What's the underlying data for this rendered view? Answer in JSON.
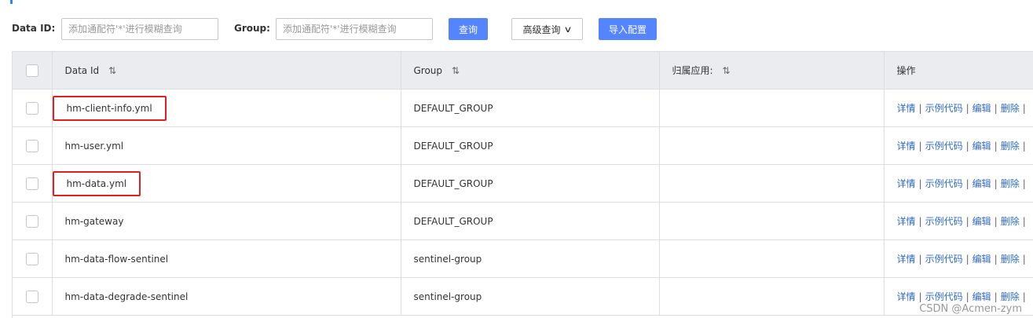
{
  "filters": {
    "data_id_label": "Data ID:",
    "data_id_placeholder": "添加通配符'*'进行模糊查询",
    "group_label": "Group:",
    "group_placeholder": "添加通配符'*'进行模糊查询",
    "query_button": "查询",
    "advanced_query_button": "高级查询",
    "import_button": "导入配置"
  },
  "table": {
    "headers": {
      "data_id": "Data Id",
      "group": "Group",
      "app": "归属应用:",
      "ops": "操作"
    },
    "sort_icon": "⇅",
    "rows": [
      {
        "data_id": "hm-client-info.yml",
        "group": "DEFAULT_GROUP",
        "app": "",
        "highlighted": true
      },
      {
        "data_id": "hm-user.yml",
        "group": "DEFAULT_GROUP",
        "app": "",
        "highlighted": false
      },
      {
        "data_id": "hm-data.yml",
        "group": "DEFAULT_GROUP",
        "app": "",
        "highlighted": true
      },
      {
        "data_id": "hm-gateway",
        "group": "DEFAULT_GROUP",
        "app": "",
        "highlighted": false
      },
      {
        "data_id": "hm-data-flow-sentinel",
        "group": "sentinel-group",
        "app": "",
        "highlighted": false
      },
      {
        "data_id": "hm-data-degrade-sentinel",
        "group": "sentinel-group",
        "app": "",
        "highlighted": false
      }
    ],
    "actions": [
      "详情",
      "示例代码",
      "编辑",
      "删除"
    ],
    "action_separator": "|"
  },
  "watermark": "CSDN @Acmen-zym",
  "colors": {
    "primary": "#5584ff",
    "link": "#2e6ad3",
    "highlight_box": "#e02020",
    "header_bg": "#ebecf0"
  }
}
